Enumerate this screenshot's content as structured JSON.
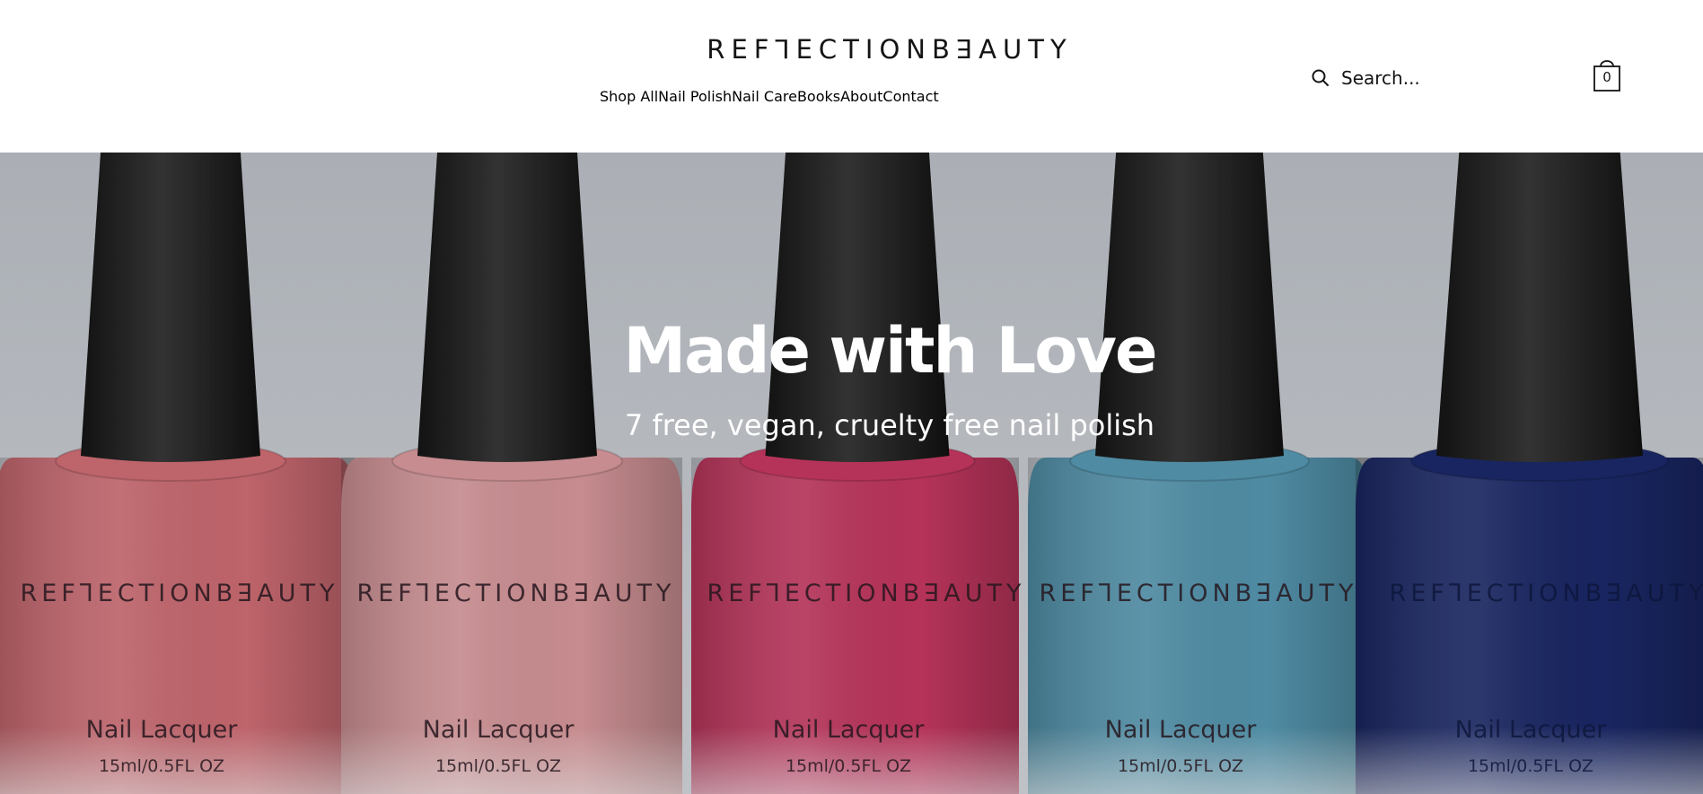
{
  "header": {
    "logo": "REFꓶECTIONBꓱAUTY",
    "nav": [
      "Shop All",
      "Nail Polish",
      "Nail Care",
      "Books",
      "About",
      "Contact"
    ],
    "search": {
      "placeholder": "Search..."
    },
    "cart": {
      "count": "0"
    }
  },
  "hero": {
    "title": "Made with Love",
    "subtitle": "7 free, vegan, cruelty free nail polish",
    "bottles": [
      {
        "brand": "REFꓶECTIONBꓱAUTY",
        "name": "Nail Lacquer",
        "size": "15ml/0.5FL OZ",
        "color": "#d9727a"
      },
      {
        "brand": "REFꓶECTIONBꓱAUTY",
        "name": "Nail Lacquer",
        "size": "15ml/0.5FL OZ",
        "color": "#e3a0a4"
      },
      {
        "brand": "REFꓶECTIONBꓱAUTY",
        "name": "Nail Lacquer",
        "size": "15ml/0.5FL OZ",
        "color": "#cf3b66"
      },
      {
        "brand": "REFꓶECTIONBꓱAUTY",
        "name": "Nail Lacquer",
        "size": "15ml/0.5FL OZ",
        "color": "#5a9fba"
      },
      {
        "brand": "REFꓶECTIONBꓱAUTY",
        "name": "Nail Lacquer",
        "size": "15ml/0.5FL OZ",
        "color": "#1d2b6e"
      }
    ]
  },
  "colors": {
    "text": "#141414",
    "background": "#ffffff",
    "hero_backdrop": "#c9ccd3"
  }
}
